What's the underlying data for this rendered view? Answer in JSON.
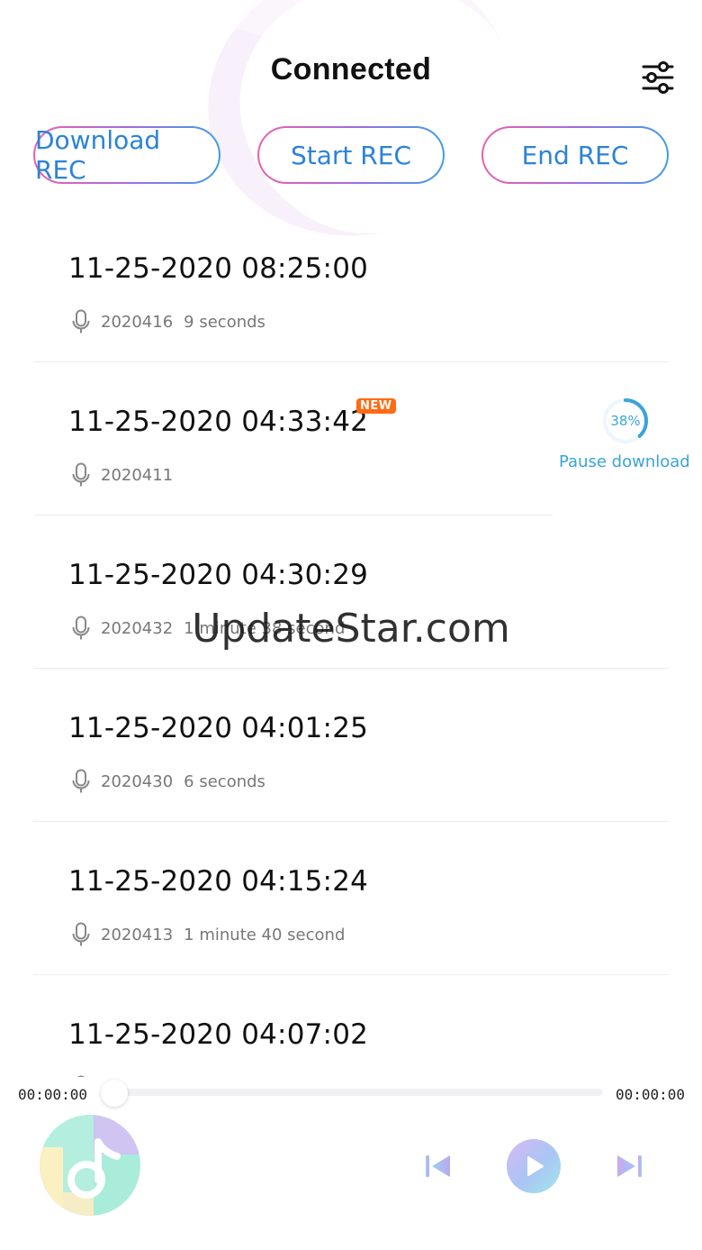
{
  "header": {
    "title": "Connected"
  },
  "buttons": {
    "download": "Download REC",
    "start": "Start REC",
    "end": "End REC"
  },
  "recordings": [
    {
      "datetime": "11-25-2020 08:25:00",
      "id": "2020416",
      "duration": "9 seconds"
    },
    {
      "datetime": "11-25-2020 04:33:42",
      "id": "2020411",
      "duration": "",
      "badge": "NEW",
      "progress": 38,
      "progress_label": "38%",
      "action": "Pause download"
    },
    {
      "datetime": "11-25-2020 04:30:29",
      "id": "2020432",
      "duration": "1 minute 38 second"
    },
    {
      "datetime": "11-25-2020 04:01:25",
      "id": "2020430",
      "duration": "6 seconds"
    },
    {
      "datetime": "11-25-2020 04:15:24",
      "id": "2020413",
      "duration": "1 minute 40 second"
    },
    {
      "datetime": "11-25-2020 04:07:02",
      "id": "",
      "duration": ""
    }
  ],
  "watermark": "UpdateStar.com",
  "player": {
    "elapsed": "00:00:00",
    "total": "00:00:00",
    "progress": 0
  },
  "colors": {
    "accent_blue": "#2b83d8",
    "gradient_pink": "#ec5fa9",
    "gradient_purple": "#9a6ee8",
    "gradient_blue": "#3f9de6",
    "progress_blue": "#3aa4d8",
    "badge_orange": "#ff6a13"
  },
  "icons": {
    "settings": "sliders-icon",
    "mic": "microphone-icon",
    "prev": "skip-previous-icon",
    "play": "play-icon",
    "next": "skip-next-icon",
    "album": "music-note-icon"
  }
}
